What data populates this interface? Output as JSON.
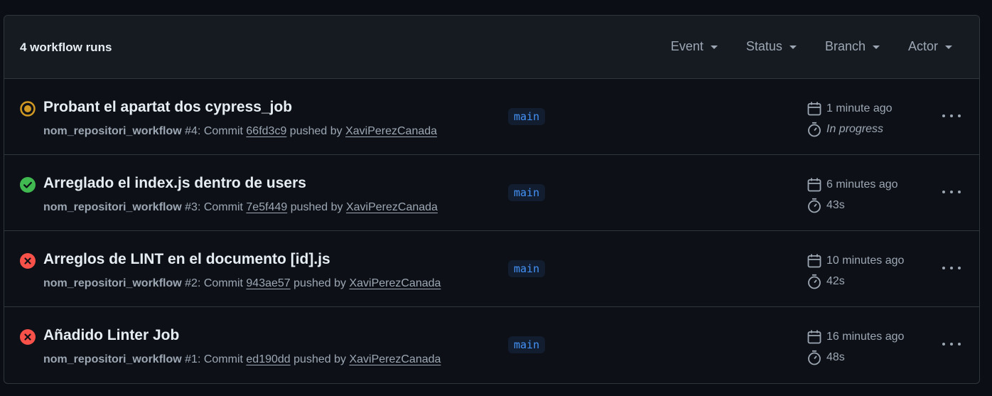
{
  "header": {
    "title": "4 workflow runs",
    "filters": [
      {
        "label": "Event"
      },
      {
        "label": "Status"
      },
      {
        "label": "Branch"
      },
      {
        "label": "Actor"
      }
    ]
  },
  "runs": [
    {
      "status": "in-progress",
      "title": "Probant el apartat dos cypress_job",
      "workflow": "nom_repositori_workflow",
      "number": "#4",
      "commit_prefix": ": Commit ",
      "commit": "66fd3c9",
      "pushed_by_text": " pushed by ",
      "actor": "XaviPerezCanada",
      "branch": "main",
      "time_ago": "1 minute ago",
      "duration": "In progress"
    },
    {
      "status": "success",
      "title": "Arreglado el index.js dentro de users",
      "workflow": "nom_repositori_workflow",
      "number": "#3",
      "commit_prefix": ": Commit ",
      "commit": "7e5f449",
      "pushed_by_text": " pushed by ",
      "actor": "XaviPerezCanada",
      "branch": "main",
      "time_ago": "6 minutes ago",
      "duration": "43s"
    },
    {
      "status": "failure",
      "title": "Arreglos de LINT en el documento [id].js",
      "workflow": "nom_repositori_workflow",
      "number": "#2",
      "commit_prefix": ": Commit ",
      "commit": "943ae57",
      "pushed_by_text": " pushed by ",
      "actor": "XaviPerezCanada",
      "branch": "main",
      "time_ago": "10 minutes ago",
      "duration": "42s"
    },
    {
      "status": "failure",
      "title": "Añadido Linter Job",
      "workflow": "nom_repositori_workflow",
      "number": "#1",
      "commit_prefix": ": Commit ",
      "commit": "ed190dd",
      "pushed_by_text": " pushed by ",
      "actor": "XaviPerezCanada",
      "branch": "main",
      "time_ago": "16 minutes ago",
      "duration": "48s"
    }
  ],
  "colors": {
    "success": "#3fb950",
    "failure": "#f85149",
    "in_progress": "#d29922",
    "link": "#4493f8"
  }
}
